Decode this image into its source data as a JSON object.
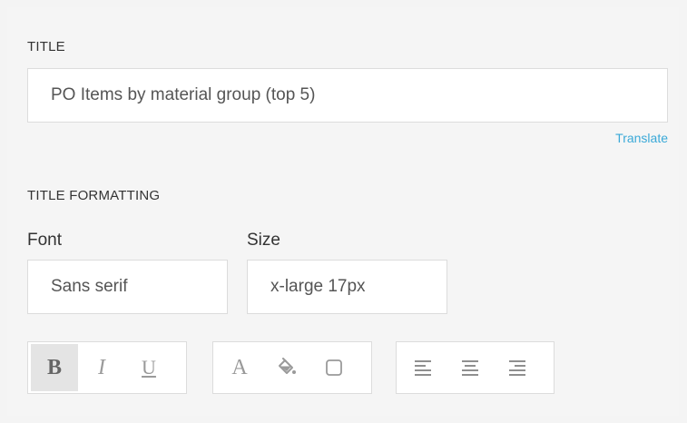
{
  "title_section": {
    "label": "TITLE",
    "input_value": "PO Items by material group (top 5)",
    "translate_label": "Translate"
  },
  "formatting_section": {
    "label": "TITLE FORMATTING",
    "font_label": "Font",
    "font_value": "Sans serif",
    "size_label": "Size",
    "size_value": "x-large 17px"
  },
  "toolbar": {
    "bold_glyph": "B",
    "italic_glyph": "I",
    "underline_glyph": "U",
    "font_color_glyph": "A",
    "bold_active": true
  },
  "colors": {
    "accent_link": "#3aa9d8",
    "active_button_bg": "#e4e4e4",
    "panel_bg": "#f5f5f5"
  }
}
